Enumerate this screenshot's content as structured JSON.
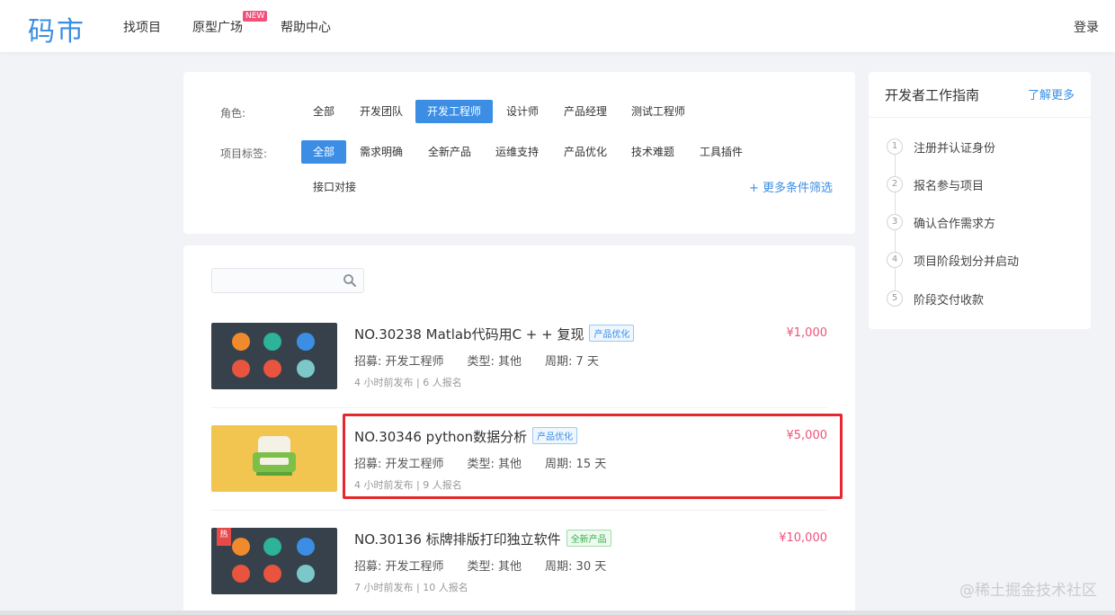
{
  "header": {
    "logo": "码市",
    "nav": [
      "找项目",
      "原型广场",
      "帮助中心"
    ],
    "new_badge": "NEW",
    "login": "登录"
  },
  "filters": {
    "role_label": "角色:",
    "roles": [
      "全部",
      "开发团队",
      "开发工程师",
      "设计师",
      "产品经理",
      "测试工程师"
    ],
    "role_active": "开发工程师",
    "tag_label": "项目标签:",
    "tags": [
      "全部",
      "需求明确",
      "全新产品",
      "运维支持",
      "产品优化",
      "技术难题",
      "工具插件",
      "接口对接"
    ],
    "tag_active": "全部",
    "more": "+ 更多条件筛选"
  },
  "search": {
    "placeholder": ""
  },
  "projects": [
    {
      "title": "NO.30238  Matlab代码用C + + 复现",
      "tag": "产品优化",
      "tag_color": "blue",
      "recruit": "招募:  开发工程师",
      "type": "类型:  其他",
      "period": "周期:  7 天",
      "sub": "4 小时前发布  |  6 人报名",
      "price": "¥1,000",
      "thumb": "icons-dark",
      "hot": false
    },
    {
      "title": "NO.30346  python数据分析",
      "tag": "产品优化",
      "tag_color": "blue",
      "recruit": "招募:  开发工程师",
      "type": "类型:  其他",
      "period": "周期:  15 天",
      "sub": "4 小时前发布  |  9 人报名",
      "price": "¥5,000",
      "thumb": "sofa-yellow",
      "hot": false
    },
    {
      "title": "NO.30136  标牌排版打印独立软件",
      "tag": "全新产品",
      "tag_color": "green",
      "recruit": "招募:  开发工程师",
      "type": "类型:  其他",
      "period": "周期:  30 天",
      "sub": "7 小时前发布  |  10 人报名",
      "price": "¥10,000",
      "thumb": "icons-dark",
      "hot": true,
      "hot_label": "热"
    }
  ],
  "guide": {
    "title": "开发者工作指南",
    "more": "了解更多",
    "steps": [
      {
        "num": "1",
        "label": "注册并认证身份"
      },
      {
        "num": "2",
        "label": "报名参与项目"
      },
      {
        "num": "3",
        "label": "确认合作需求方"
      },
      {
        "num": "4",
        "label": "项目阶段划分并启动"
      },
      {
        "num": "5",
        "label": "阶段交付收款"
      }
    ]
  },
  "watermark": "@稀土掘金技术社区",
  "colors": {
    "accent": "#3b8ee4",
    "price": "#f0527a",
    "highlight": "#e5282d"
  }
}
